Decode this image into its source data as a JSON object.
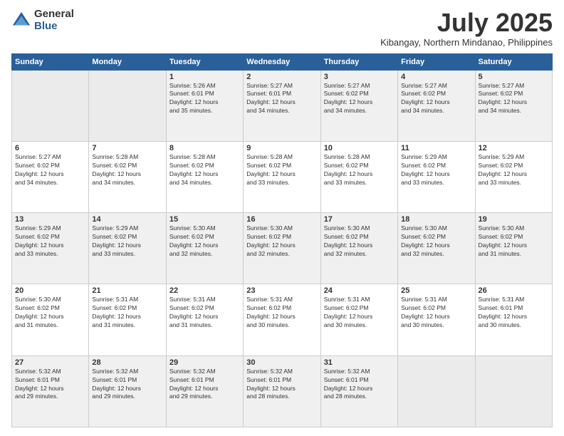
{
  "logo": {
    "general": "General",
    "blue": "Blue"
  },
  "title": "July 2025",
  "location": "Kibangay, Northern Mindanao, Philippines",
  "days_of_week": [
    "Sunday",
    "Monday",
    "Tuesday",
    "Wednesday",
    "Thursday",
    "Friday",
    "Saturday"
  ],
  "weeks": [
    [
      {
        "num": "",
        "info": ""
      },
      {
        "num": "",
        "info": ""
      },
      {
        "num": "1",
        "info": "Sunrise: 5:26 AM\nSunset: 6:01 PM\nDaylight: 12 hours\nand 35 minutes."
      },
      {
        "num": "2",
        "info": "Sunrise: 5:27 AM\nSunset: 6:01 PM\nDaylight: 12 hours\nand 34 minutes."
      },
      {
        "num": "3",
        "info": "Sunrise: 5:27 AM\nSunset: 6:02 PM\nDaylight: 12 hours\nand 34 minutes."
      },
      {
        "num": "4",
        "info": "Sunrise: 5:27 AM\nSunset: 6:02 PM\nDaylight: 12 hours\nand 34 minutes."
      },
      {
        "num": "5",
        "info": "Sunrise: 5:27 AM\nSunset: 6:02 PM\nDaylight: 12 hours\nand 34 minutes."
      }
    ],
    [
      {
        "num": "6",
        "info": "Sunrise: 5:27 AM\nSunset: 6:02 PM\nDaylight: 12 hours\nand 34 minutes."
      },
      {
        "num": "7",
        "info": "Sunrise: 5:28 AM\nSunset: 6:02 PM\nDaylight: 12 hours\nand 34 minutes."
      },
      {
        "num": "8",
        "info": "Sunrise: 5:28 AM\nSunset: 6:02 PM\nDaylight: 12 hours\nand 34 minutes."
      },
      {
        "num": "9",
        "info": "Sunrise: 5:28 AM\nSunset: 6:02 PM\nDaylight: 12 hours\nand 33 minutes."
      },
      {
        "num": "10",
        "info": "Sunrise: 5:28 AM\nSunset: 6:02 PM\nDaylight: 12 hours\nand 33 minutes."
      },
      {
        "num": "11",
        "info": "Sunrise: 5:29 AM\nSunset: 6:02 PM\nDaylight: 12 hours\nand 33 minutes."
      },
      {
        "num": "12",
        "info": "Sunrise: 5:29 AM\nSunset: 6:02 PM\nDaylight: 12 hours\nand 33 minutes."
      }
    ],
    [
      {
        "num": "13",
        "info": "Sunrise: 5:29 AM\nSunset: 6:02 PM\nDaylight: 12 hours\nand 33 minutes."
      },
      {
        "num": "14",
        "info": "Sunrise: 5:29 AM\nSunset: 6:02 PM\nDaylight: 12 hours\nand 33 minutes."
      },
      {
        "num": "15",
        "info": "Sunrise: 5:30 AM\nSunset: 6:02 PM\nDaylight: 12 hours\nand 32 minutes."
      },
      {
        "num": "16",
        "info": "Sunrise: 5:30 AM\nSunset: 6:02 PM\nDaylight: 12 hours\nand 32 minutes."
      },
      {
        "num": "17",
        "info": "Sunrise: 5:30 AM\nSunset: 6:02 PM\nDaylight: 12 hours\nand 32 minutes."
      },
      {
        "num": "18",
        "info": "Sunrise: 5:30 AM\nSunset: 6:02 PM\nDaylight: 12 hours\nand 32 minutes."
      },
      {
        "num": "19",
        "info": "Sunrise: 5:30 AM\nSunset: 6:02 PM\nDaylight: 12 hours\nand 31 minutes."
      }
    ],
    [
      {
        "num": "20",
        "info": "Sunrise: 5:30 AM\nSunset: 6:02 PM\nDaylight: 12 hours\nand 31 minutes."
      },
      {
        "num": "21",
        "info": "Sunrise: 5:31 AM\nSunset: 6:02 PM\nDaylight: 12 hours\nand 31 minutes."
      },
      {
        "num": "22",
        "info": "Sunrise: 5:31 AM\nSunset: 6:02 PM\nDaylight: 12 hours\nand 31 minutes."
      },
      {
        "num": "23",
        "info": "Sunrise: 5:31 AM\nSunset: 6:02 PM\nDaylight: 12 hours\nand 30 minutes."
      },
      {
        "num": "24",
        "info": "Sunrise: 5:31 AM\nSunset: 6:02 PM\nDaylight: 12 hours\nand 30 minutes."
      },
      {
        "num": "25",
        "info": "Sunrise: 5:31 AM\nSunset: 6:02 PM\nDaylight: 12 hours\nand 30 minutes."
      },
      {
        "num": "26",
        "info": "Sunrise: 5:31 AM\nSunset: 6:01 PM\nDaylight: 12 hours\nand 30 minutes."
      }
    ],
    [
      {
        "num": "27",
        "info": "Sunrise: 5:32 AM\nSunset: 6:01 PM\nDaylight: 12 hours\nand 29 minutes."
      },
      {
        "num": "28",
        "info": "Sunrise: 5:32 AM\nSunset: 6:01 PM\nDaylight: 12 hours\nand 29 minutes."
      },
      {
        "num": "29",
        "info": "Sunrise: 5:32 AM\nSunset: 6:01 PM\nDaylight: 12 hours\nand 29 minutes."
      },
      {
        "num": "30",
        "info": "Sunrise: 5:32 AM\nSunset: 6:01 PM\nDaylight: 12 hours\nand 28 minutes."
      },
      {
        "num": "31",
        "info": "Sunrise: 5:32 AM\nSunset: 6:01 PM\nDaylight: 12 hours\nand 28 minutes."
      },
      {
        "num": "",
        "info": ""
      },
      {
        "num": "",
        "info": ""
      }
    ]
  ]
}
